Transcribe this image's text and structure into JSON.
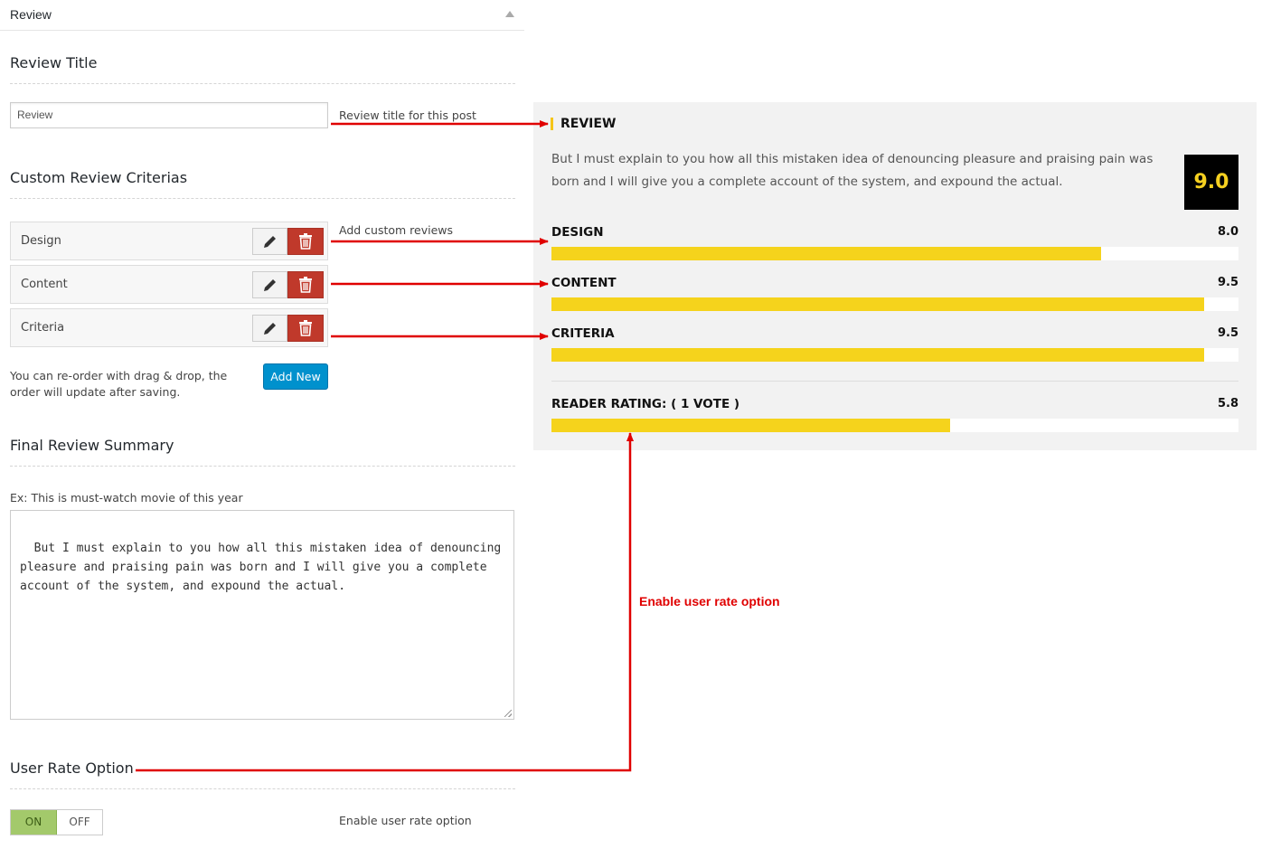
{
  "panel": {
    "title": "Review"
  },
  "review_title": {
    "heading": "Review Title",
    "input_value": "Review",
    "help": "Review title for this post"
  },
  "criteria": {
    "heading": "Custom Review Criterias",
    "help": "Add custom reviews",
    "items": [
      {
        "label": "Design"
      },
      {
        "label": "Content"
      },
      {
        "label": "Criteria"
      }
    ],
    "reorder_help": "You can re-order with drag & drop, the order will update after saving.",
    "add_new_label": "Add New"
  },
  "summary": {
    "heading": "Final Review Summary",
    "hint": "Ex: This is must-watch movie of this year",
    "text": "But I must explain to you how all this mistaken idea of denouncing\npleasure and praising pain was born and I will give you a complete\naccount of the system, and expound the actual."
  },
  "user_rate": {
    "heading": "User Rate Option",
    "on_label": "ON",
    "off_label": "OFF",
    "help": "Enable user rate option"
  },
  "preview": {
    "heading": "REVIEW",
    "description": "But I must explain to you how all this mistaken idea of denouncing pleasure and praising pain was born and I will give you a complete account of the system, and expound the actual.",
    "overall_score": "9.0",
    "criteria": [
      {
        "name": "DESIGN",
        "score": "8.0",
        "fraction": 0.8
      },
      {
        "name": "CONTENT",
        "score": "9.5",
        "fraction": 0.95
      },
      {
        "name": "CRITERIA",
        "score": "9.5",
        "fraction": 0.95
      }
    ],
    "reader": {
      "name": "READER RATING: ( 1 VOTE )",
      "score": "5.8",
      "fraction": 0.58
    }
  },
  "annotation": {
    "label": "Enable user rate option",
    "color": "#e00000"
  },
  "colors": {
    "bar": "#f5d31c",
    "score_bg": "#000000",
    "score_text": "#f5d020",
    "delete": "#c0392b",
    "add_new": "#0091cd",
    "toggle_on": "#a3c96b"
  }
}
